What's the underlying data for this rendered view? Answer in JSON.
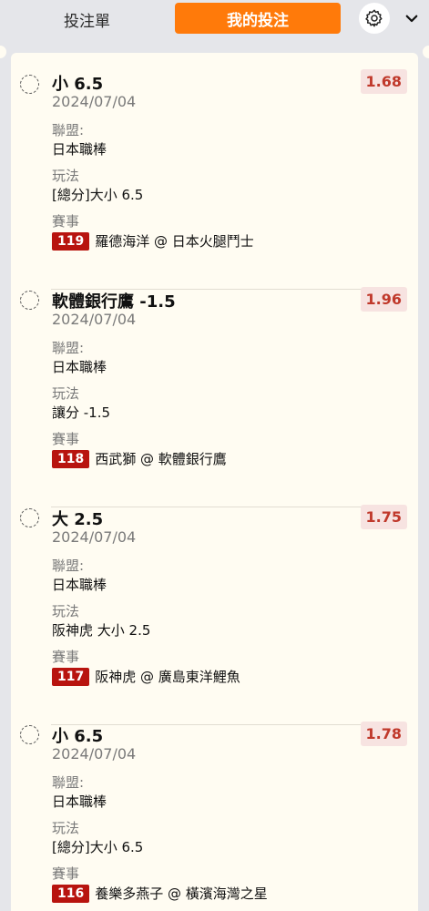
{
  "header": {
    "tab_slip": "投注單",
    "tab_mybets": "我的投注",
    "settings_icon": "gear-icon",
    "dropdown_icon": "chevron-down-icon"
  },
  "labels": {
    "league": "聯盟:",
    "market": "玩法",
    "event": "賽事"
  },
  "bets": [
    {
      "selection": "小 6.5",
      "odds": "1.68",
      "date": "2024/07/04",
      "league": "日本職棒",
      "market": "[總分]大小 6.5",
      "match_no": "119",
      "match": "羅德海洋 @ 日本火腿鬥士"
    },
    {
      "selection": "軟體銀行鷹 -1.5",
      "odds": "1.96",
      "date": "2024/07/04",
      "league": "日本職棒",
      "market": "讓分 -1.5",
      "match_no": "118",
      "match": "西武獅 @ 軟體銀行鷹"
    },
    {
      "selection": "大 2.5",
      "odds": "1.75",
      "date": "2024/07/04",
      "league": "日本職棒",
      "market": "阪神虎 大小 2.5",
      "match_no": "117",
      "match": "阪神虎 @ 廣島東洋鯉魚"
    },
    {
      "selection": "小 6.5",
      "odds": "1.78",
      "date": "2024/07/04",
      "league": "日本職棒",
      "market": "[總分]大小 6.5",
      "match_no": "116",
      "match": "養樂多燕子 @ 橫濱海灣之星"
    }
  ],
  "colors": {
    "accent": "#ff7a0a",
    "match_badge": "#b8140f",
    "odds_text": "#c0392b",
    "odds_bg": "#f7e3e1",
    "panel_bg": "#fffcf2"
  }
}
